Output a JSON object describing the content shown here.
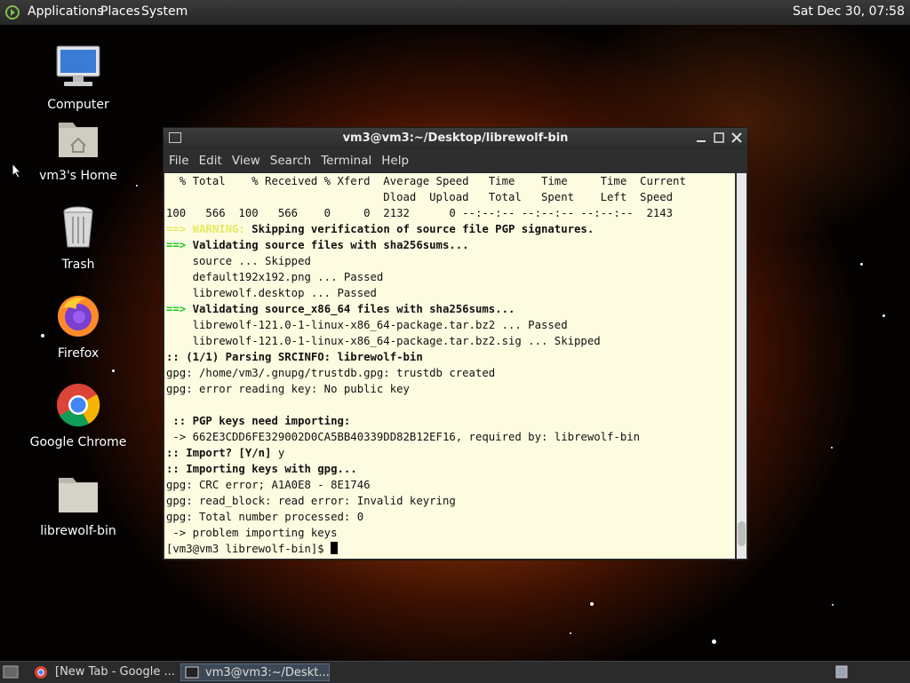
{
  "top_panel": {
    "menus": [
      "Applications",
      "Places",
      "System"
    ],
    "clock": "Sat Dec 30, 07:58"
  },
  "desktop_icons": [
    {
      "label": "Computer",
      "icon": "computer-icon"
    },
    {
      "label": "vm3's Home",
      "icon": "home-folder-icon"
    },
    {
      "label": "Trash",
      "icon": "trash-icon"
    },
    {
      "label": "Firefox",
      "icon": "firefox-icon"
    },
    {
      "label": "Google Chrome",
      "icon": "chrome-icon"
    },
    {
      "label": "librewolf-bin",
      "icon": "folder-icon"
    }
  ],
  "terminal": {
    "title": "vm3@vm3:~/Desktop/librewolf-bin",
    "menu": [
      "File",
      "Edit",
      "View",
      "Search",
      "Terminal",
      "Help"
    ],
    "lines": [
      {
        "segments": [
          {
            "text": "  % Total    % Received % Xferd  Average Speed   Time    Time     Time  Current",
            "style": ""
          }
        ]
      },
      {
        "segments": [
          {
            "text": "                                 Dload  Upload   Total   Spent    Left  Speed",
            "style": ""
          }
        ]
      },
      {
        "segments": [
          {
            "text": "100   566  100   566    0     0  2132      0 --:--:-- --:--:-- --:--:--  2143",
            "style": ""
          }
        ]
      },
      {
        "segments": [
          {
            "text": "==> WARNING:",
            "style": "ylw"
          },
          {
            "text": " Skipping verification of source file PGP signatures.",
            "style": "b"
          }
        ]
      },
      {
        "segments": [
          {
            "text": "==>",
            "style": "grn"
          },
          {
            "text": " Validating source files with sha256sums...",
            "style": "b"
          }
        ]
      },
      {
        "segments": [
          {
            "text": "    source ... Skipped",
            "style": ""
          }
        ]
      },
      {
        "segments": [
          {
            "text": "    default192x192.png ... Passed",
            "style": ""
          }
        ]
      },
      {
        "segments": [
          {
            "text": "    librewolf.desktop ... Passed",
            "style": ""
          }
        ]
      },
      {
        "segments": [
          {
            "text": "==>",
            "style": "grn"
          },
          {
            "text": " Validating source_x86_64 files with sha256sums...",
            "style": "b"
          }
        ]
      },
      {
        "segments": [
          {
            "text": "    librewolf-121.0-1-linux-x86_64-package.tar.bz2 ... Passed",
            "style": ""
          }
        ]
      },
      {
        "segments": [
          {
            "text": "    librewolf-121.0-1-linux-x86_64-package.tar.bz2.sig ... Skipped",
            "style": ""
          }
        ]
      },
      {
        "segments": [
          {
            "text": ":: (1/1) Parsing SRCINFO: librewolf-bin",
            "style": "b"
          }
        ]
      },
      {
        "segments": [
          {
            "text": "gpg: /home/vm3/.gnupg/trustdb.gpg: trustdb created",
            "style": ""
          }
        ]
      },
      {
        "segments": [
          {
            "text": "gpg: error reading key: No public key",
            "style": ""
          }
        ]
      },
      {
        "segments": [
          {
            "text": "",
            "style": ""
          }
        ]
      },
      {
        "segments": [
          {
            "text": " :: PGP keys need importing:",
            "style": "b"
          }
        ]
      },
      {
        "segments": [
          {
            "text": " -> 662E3CDD6FE329002D0CA5BB40339DD82B12EF16, required by: librewolf-bin",
            "style": ""
          }
        ]
      },
      {
        "segments": [
          {
            "text": ":: Import? [Y/n]",
            "style": "b"
          },
          {
            "text": " y",
            "style": ""
          }
        ]
      },
      {
        "segments": [
          {
            "text": ":: Importing keys with gpg...",
            "style": "b"
          }
        ]
      },
      {
        "segments": [
          {
            "text": "gpg: CRC error; A1A0E8 - 8E1746",
            "style": ""
          }
        ]
      },
      {
        "segments": [
          {
            "text": "gpg: read_block: read error: Invalid keyring",
            "style": ""
          }
        ]
      },
      {
        "segments": [
          {
            "text": "gpg: Total number processed: 0",
            "style": ""
          }
        ]
      },
      {
        "segments": [
          {
            "text": " -> problem importing keys",
            "style": ""
          }
        ]
      }
    ],
    "prompt": "[vm3@vm3 librewolf-bin]$ "
  },
  "taskbar": {
    "tasks": [
      {
        "label": "[New Tab - Google ...",
        "icon": "chrome-icon",
        "active": false
      },
      {
        "label": "vm3@vm3:~/Deskt...",
        "icon": "terminal-icon",
        "active": true
      }
    ]
  },
  "colors": {
    "terminal_bg": "#fdfce1",
    "prompt_green": "#18c418",
    "warning_yellow": "#e8e860",
    "panel": "#2b2b2b"
  }
}
